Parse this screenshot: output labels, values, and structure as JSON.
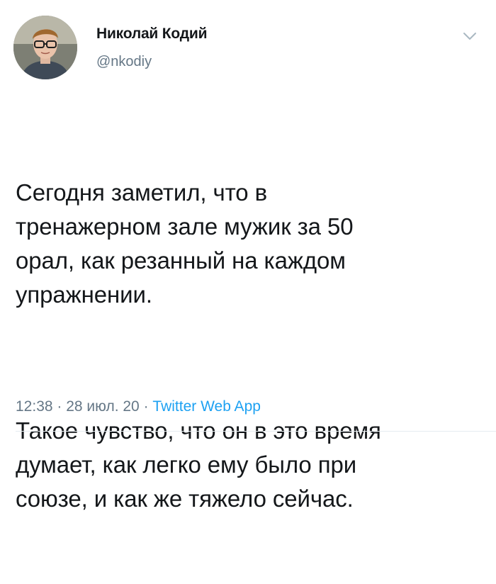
{
  "author": {
    "display_name": "Николай Кодий",
    "handle": "@nkodiy",
    "avatar_icon": "user-photo-avatar"
  },
  "tweet": {
    "paragraphs": [
      "Сегодня заметил, что в\nтренажерном зале мужик за 50\nорал, как резанный на каждом\nупражнении.",
      "Такое чувство, что он в это время\nдумает, как легко ему было при\nсоюзе, и как же тяжело сейчас."
    ]
  },
  "meta": {
    "time": "12:38",
    "separator_1": " · ",
    "date": "28 июл. 20",
    "separator_2": " · ",
    "source": "Twitter Web App"
  },
  "menu": {
    "icon": "chevron-down-icon"
  },
  "colors": {
    "text": "#14171a",
    "secondary": "#657786",
    "accent": "#1da1f2",
    "divider": "#e6ecf0"
  }
}
